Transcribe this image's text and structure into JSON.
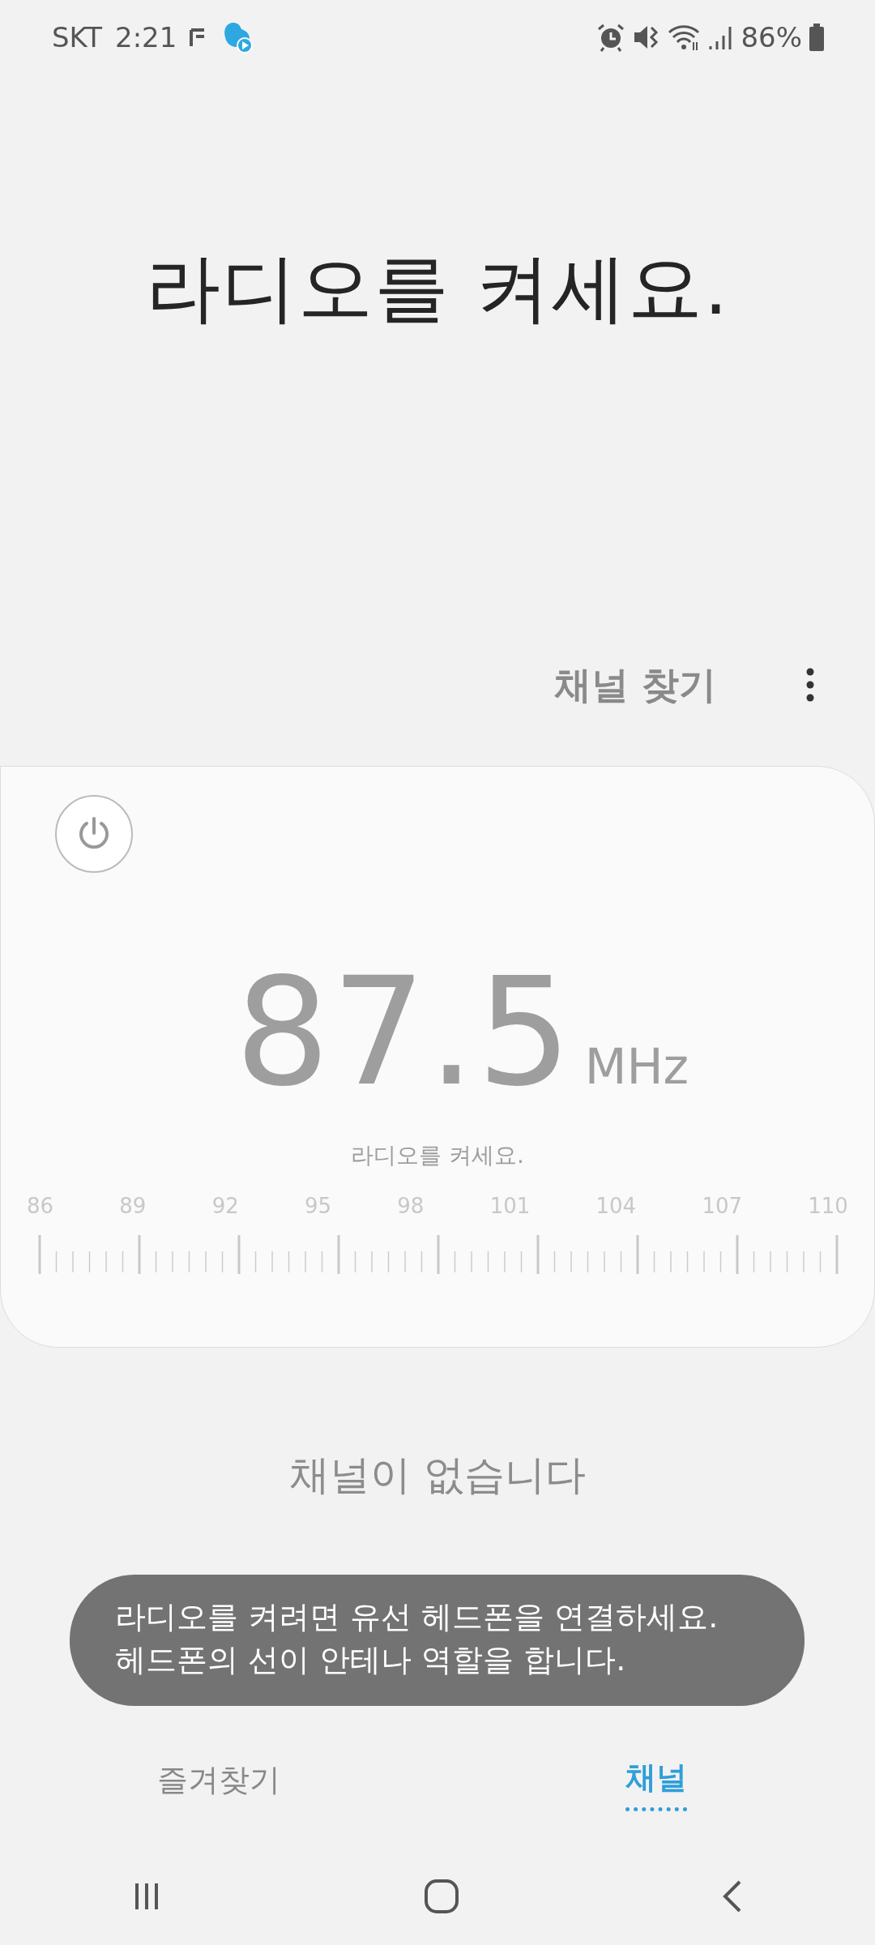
{
  "status_bar": {
    "carrier": "SKT",
    "time": "2:21",
    "battery": "86%"
  },
  "headline": "라디오를 켜세요.",
  "actions": {
    "scan": "채널 찾기"
  },
  "tuner": {
    "power_on": false,
    "frequency": "87.5",
    "unit": "MHz",
    "message": "라디오를 켜세요.",
    "scale_labels": [
      "86",
      "89",
      "92",
      "95",
      "98",
      "101",
      "104",
      "107",
      "110"
    ]
  },
  "channels": {
    "empty_title": "채널이 없습니다"
  },
  "toast": {
    "text": "라디오를 켜려면 유선 헤드폰을 연결하세요.\n헤드폰의 선이 안테나 역할을 합니다."
  },
  "tabs": [
    {
      "label": "즐겨찾기",
      "selected": false
    },
    {
      "label": "채널",
      "selected": true
    }
  ]
}
